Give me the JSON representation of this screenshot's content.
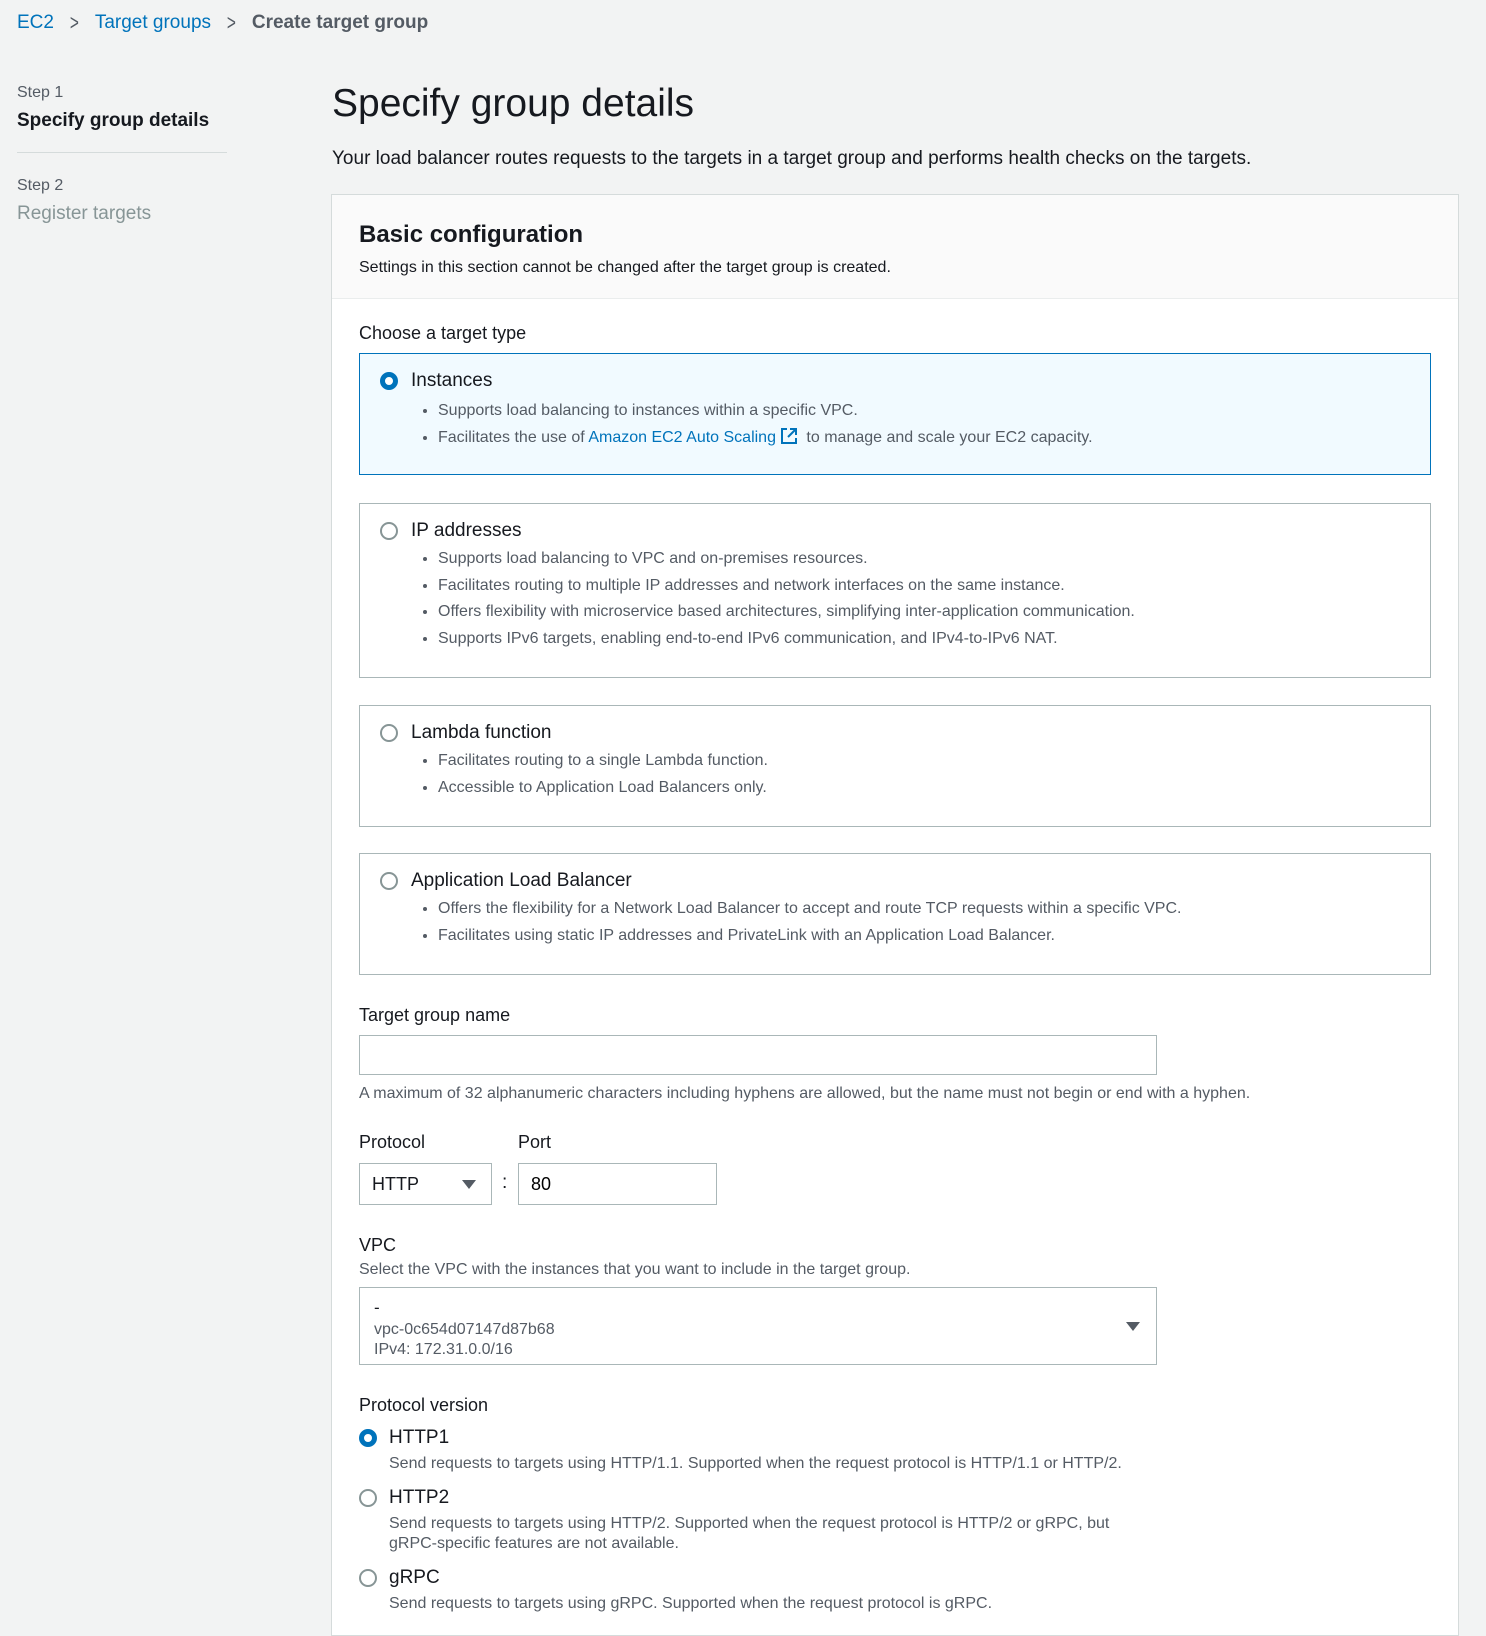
{
  "breadcrumb": {
    "items": [
      "EC2",
      "Target groups"
    ],
    "current": "Create target group"
  },
  "steps": [
    {
      "number": "Step 1",
      "title": "Specify group details",
      "active": true
    },
    {
      "number": "Step 2",
      "title": "Register targets",
      "active": false
    }
  ],
  "page": {
    "title": "Specify group details",
    "description": "Your load balancer routes requests to the targets in a target group and performs health checks on the targets."
  },
  "basic_config": {
    "title": "Basic configuration",
    "subtitle": "Settings in this section cannot be changed after the target group is created.",
    "target_type_label": "Choose a target type",
    "target_types": [
      {
        "title": "Instances",
        "selected": true,
        "bullets": [
          "Supports load balancing to instances within a specific VPC."
        ],
        "link_bullet": {
          "before": "Facilitates the use of ",
          "link": "Amazon EC2 Auto Scaling",
          "after": " to manage and scale your EC2 capacity."
        }
      },
      {
        "title": "IP addresses",
        "selected": false,
        "bullets": [
          "Supports load balancing to VPC and on-premises resources.",
          "Facilitates routing to multiple IP addresses and network interfaces on the same instance.",
          "Offers flexibility with microservice based architectures, simplifying inter-application communication.",
          "Supports IPv6 targets, enabling end-to-end IPv6 communication, and IPv4-to-IPv6 NAT."
        ]
      },
      {
        "title": "Lambda function",
        "selected": false,
        "bullets": [
          "Facilitates routing to a single Lambda function.",
          "Accessible to Application Load Balancers only."
        ]
      },
      {
        "title": "Application Load Balancer",
        "selected": false,
        "bullets": [
          "Offers the flexibility for a Network Load Balancer to accept and route TCP requests within a specific VPC.",
          "Facilitates using static IP addresses and PrivateLink with an Application Load Balancer."
        ]
      }
    ],
    "name_label": "Target group name",
    "name_value": "",
    "name_hint": "A maximum of 32 alphanumeric characters including hyphens are allowed, but the name must not begin or end with a hyphen.",
    "protocol_label": "Protocol",
    "protocol_value": "HTTP",
    "port_separator": ":",
    "port_label": "Port",
    "port_value": "80",
    "vpc_label": "VPC",
    "vpc_desc": "Select the VPC with the instances that you want to include in the target group.",
    "vpc_value": {
      "name": "-",
      "id": "vpc-0c654d07147d87b68",
      "cidr": "IPv4: 172.31.0.0/16"
    },
    "protocol_version_label": "Protocol version",
    "protocol_versions": [
      {
        "label": "HTTP1",
        "desc": "Send requests to targets using HTTP/1.1. Supported when the request protocol is HTTP/1.1 or HTTP/2.",
        "selected": true
      },
      {
        "label": "HTTP2",
        "desc": "Send requests to targets using HTTP/2. Supported when the request protocol is HTTP/2 or gRPC, but gRPC-specific features are not available.",
        "selected": false
      },
      {
        "label": "gRPC",
        "desc": "Send requests to targets using gRPC. Supported when the request protocol is gRPC.",
        "selected": false
      }
    ]
  },
  "colors": {
    "link": "#0073bb",
    "selected_bg": "#f1faff",
    "border": "#aab7b8"
  }
}
